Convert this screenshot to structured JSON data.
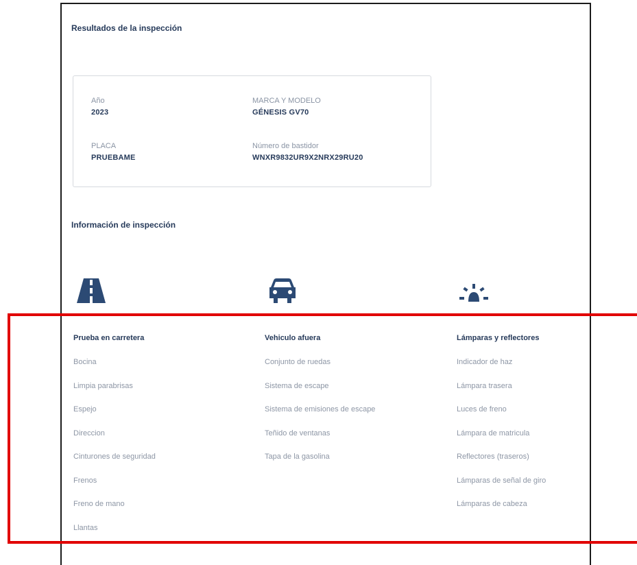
{
  "inspection_results": {
    "title": "Resultados de la inspección",
    "vehicle": {
      "year_label": "Año",
      "year_value": "2023",
      "make_model_label": "MARCA Y MODELO",
      "make_model_value": "GÉNESIS GV70",
      "plate_label": "PLACA",
      "plate_value": "PRUEBAME",
      "vin_label": "Número de bastidor",
      "vin_value": "WNXR9832UR9X2NRX29RU20"
    }
  },
  "inspection_info": {
    "title": "Información de inspección",
    "icons": [
      "road-icon",
      "car-icon",
      "lamp-icon"
    ],
    "columns": [
      {
        "heading": "Prueba en carretera",
        "items": [
          "Bocina",
          "Limpia parabrisas",
          "Espejo",
          "Direccion",
          "Cinturones de seguridad",
          "Frenos",
          "Freno de mano",
          "Llantas"
        ]
      },
      {
        "heading": "Vehiculo afuera",
        "items": [
          "Conjunto de ruedas",
          "Sistema de escape",
          "Sistema de emisiones de escape",
          "Teñido de ventanas",
          "Tapa de la gasolina"
        ]
      },
      {
        "heading": "Lámparas y reflectores",
        "items": [
          "Indicador de haz",
          "Lámpara trasera",
          "Luces de freno",
          "Lámpara de matricula",
          "Reflectores (traseros)",
          "Lámparas de señal de giro",
          "Lámparas de cabeza"
        ]
      }
    ]
  },
  "colors": {
    "accent": "#263a5a",
    "muted_text": "#8d96a5",
    "highlight_border": "#e10000"
  }
}
